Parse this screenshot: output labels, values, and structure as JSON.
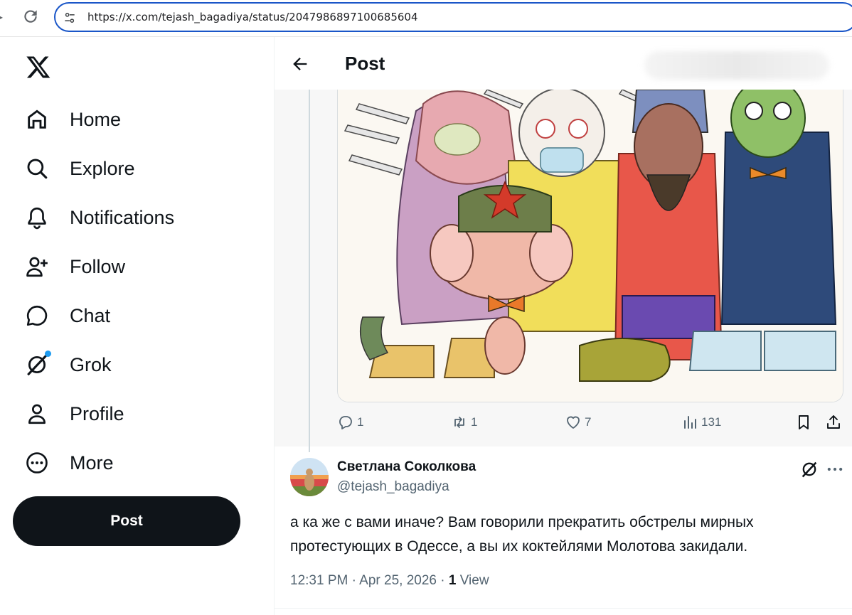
{
  "browser": {
    "url": "https://x.com/tejash_bagadiya/status/2047986897100685604"
  },
  "sidebar": {
    "items": [
      {
        "label": "Home",
        "icon": "home-icon"
      },
      {
        "label": "Explore",
        "icon": "search-icon"
      },
      {
        "label": "Notifications",
        "icon": "bell-icon"
      },
      {
        "label": "Follow",
        "icon": "add-person-icon"
      },
      {
        "label": "Chat",
        "icon": "chat-bubble-icon"
      },
      {
        "label": "Grok",
        "icon": "grok-icon"
      },
      {
        "label": "Profile",
        "icon": "person-icon"
      },
      {
        "label": "More",
        "icon": "more-circle-icon"
      }
    ],
    "post_button": "Post"
  },
  "header": {
    "title": "Post"
  },
  "parent_post": {
    "actions": {
      "replies": "1",
      "reposts": "1",
      "likes": "7",
      "views": "131"
    }
  },
  "reply": {
    "display_name": "Светлана Соколкова",
    "handle": "@tejash_bagadiya",
    "text": "а ка же с вами иначе? Вам говорили прекратить обстрелы мирных протестующих в Одессе, а вы их коктейлями Молотова закидали.",
    "time": "12:31 PM · Apr 25, 2026 · ",
    "view_count": "1",
    "view_label": "View"
  },
  "colors": {
    "accent": "#1d9bf0",
    "text_primary": "#0f1419",
    "text_secondary": "#536471",
    "url_border": "#1a56c8"
  }
}
